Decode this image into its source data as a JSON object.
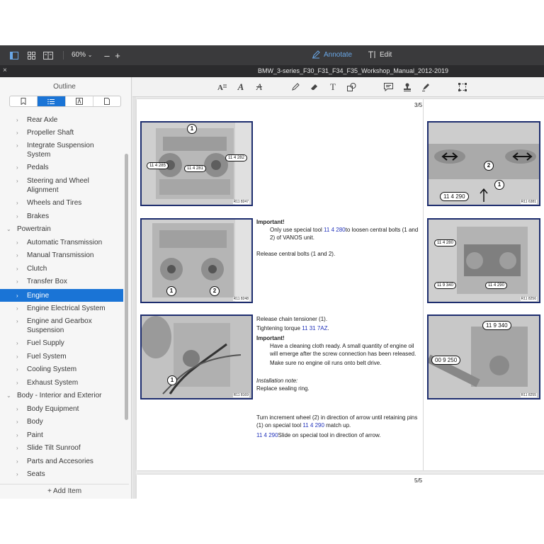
{
  "toolbar": {
    "zoom": "60%",
    "annotate_label": "Annotate",
    "edit_label": "Edit"
  },
  "document": {
    "title": "BMW_3-series_F30_F31_F34_F35_Workshop_Manual_2012-2019"
  },
  "sidebar": {
    "title": "Outline",
    "add_item": "Add Item",
    "items": [
      {
        "label": "Rear Axle",
        "level": 1
      },
      {
        "label": "Propeller Shaft",
        "level": 1
      },
      {
        "label": "Integrate Suspension System",
        "level": 1
      },
      {
        "label": "Pedals",
        "level": 1
      },
      {
        "label": "Steering and Wheel Alignment",
        "level": 1
      },
      {
        "label": "Wheels and Tires",
        "level": 1
      },
      {
        "label": "Brakes",
        "level": 1
      },
      {
        "label": "Powertrain",
        "level": 0
      },
      {
        "label": "Automatic Transmission",
        "level": 1
      },
      {
        "label": "Manual Transmission",
        "level": 1
      },
      {
        "label": "Clutch",
        "level": 1
      },
      {
        "label": "Transfer Box",
        "level": 1
      },
      {
        "label": "Engine",
        "level": 1
      },
      {
        "label": "Engine Electrical System",
        "level": 1
      },
      {
        "label": "Engine and Gearbox Suspension",
        "level": 1
      },
      {
        "label": "Fuel Supply",
        "level": 1
      },
      {
        "label": "Fuel System",
        "level": 1
      },
      {
        "label": "Cooling System",
        "level": 1
      },
      {
        "label": "Exhaust System",
        "level": 1
      },
      {
        "label": "Body - Interior and Exterior",
        "level": 0
      },
      {
        "label": "Body Equipment",
        "level": 1
      },
      {
        "label": "Body",
        "level": 1
      },
      {
        "label": "Paint",
        "level": 1
      },
      {
        "label": "Slide Tilt Sunroof",
        "level": 1
      },
      {
        "label": "Parts and Accesories",
        "level": 1
      },
      {
        "label": "Seats",
        "level": 1
      }
    ]
  },
  "page": {
    "number": "3/5",
    "next_number": "5/5",
    "fig1": {
      "ref": "R11 8247",
      "c1": "1",
      "t1": "11 4 285",
      "t2": "11 4 281",
      "t3": "11 4 282"
    },
    "fig2": {
      "ref": "R11 8248",
      "c1": "1",
      "c2": "2"
    },
    "fig3": {
      "ref": "R11 8169",
      "c1": "1"
    },
    "fig4": {
      "ref": "R11 6381",
      "c1": "1",
      "c2": "2",
      "t1": "11 4 290"
    },
    "fig5": {
      "ref": "R11 8256",
      "t1": "11 4 280",
      "t2": "11 9 340",
      "t3": "11 4 290"
    },
    "fig6": {
      "ref": "R11 8255",
      "t1": "11 9 340",
      "t2": "00 9 250"
    },
    "important1": "Important!",
    "step1a": "Only use special tool ",
    "step1_link": "11 4 280",
    "step1b": "to loosen central bolts (1 and 2) of VANOS unit.",
    "step2": "Release central bolts (1 and 2).",
    "step3": "Release chain tensioner (1).",
    "step4a": "Tightening torque ",
    "step4_link": "11 31 7AZ",
    "step4b": ".",
    "important2": "Important!",
    "step5": "Have a cleaning cloth ready. A small quantity of engine oil will emerge after the screw connection has been released.",
    "step6": "Make sure no engine oil runs onto belt drive.",
    "install_note": "Installation note:",
    "step7": "Replace sealing ring.",
    "step8a": "Turn increment wheel (2) in direction of arrow until retaining pins (1) on special tool ",
    "step8_link": "11 4 290",
    "step8b": " match up.",
    "step9_link": "11 4 290",
    "step9b": "Slide on special tool in direction of arrow."
  }
}
